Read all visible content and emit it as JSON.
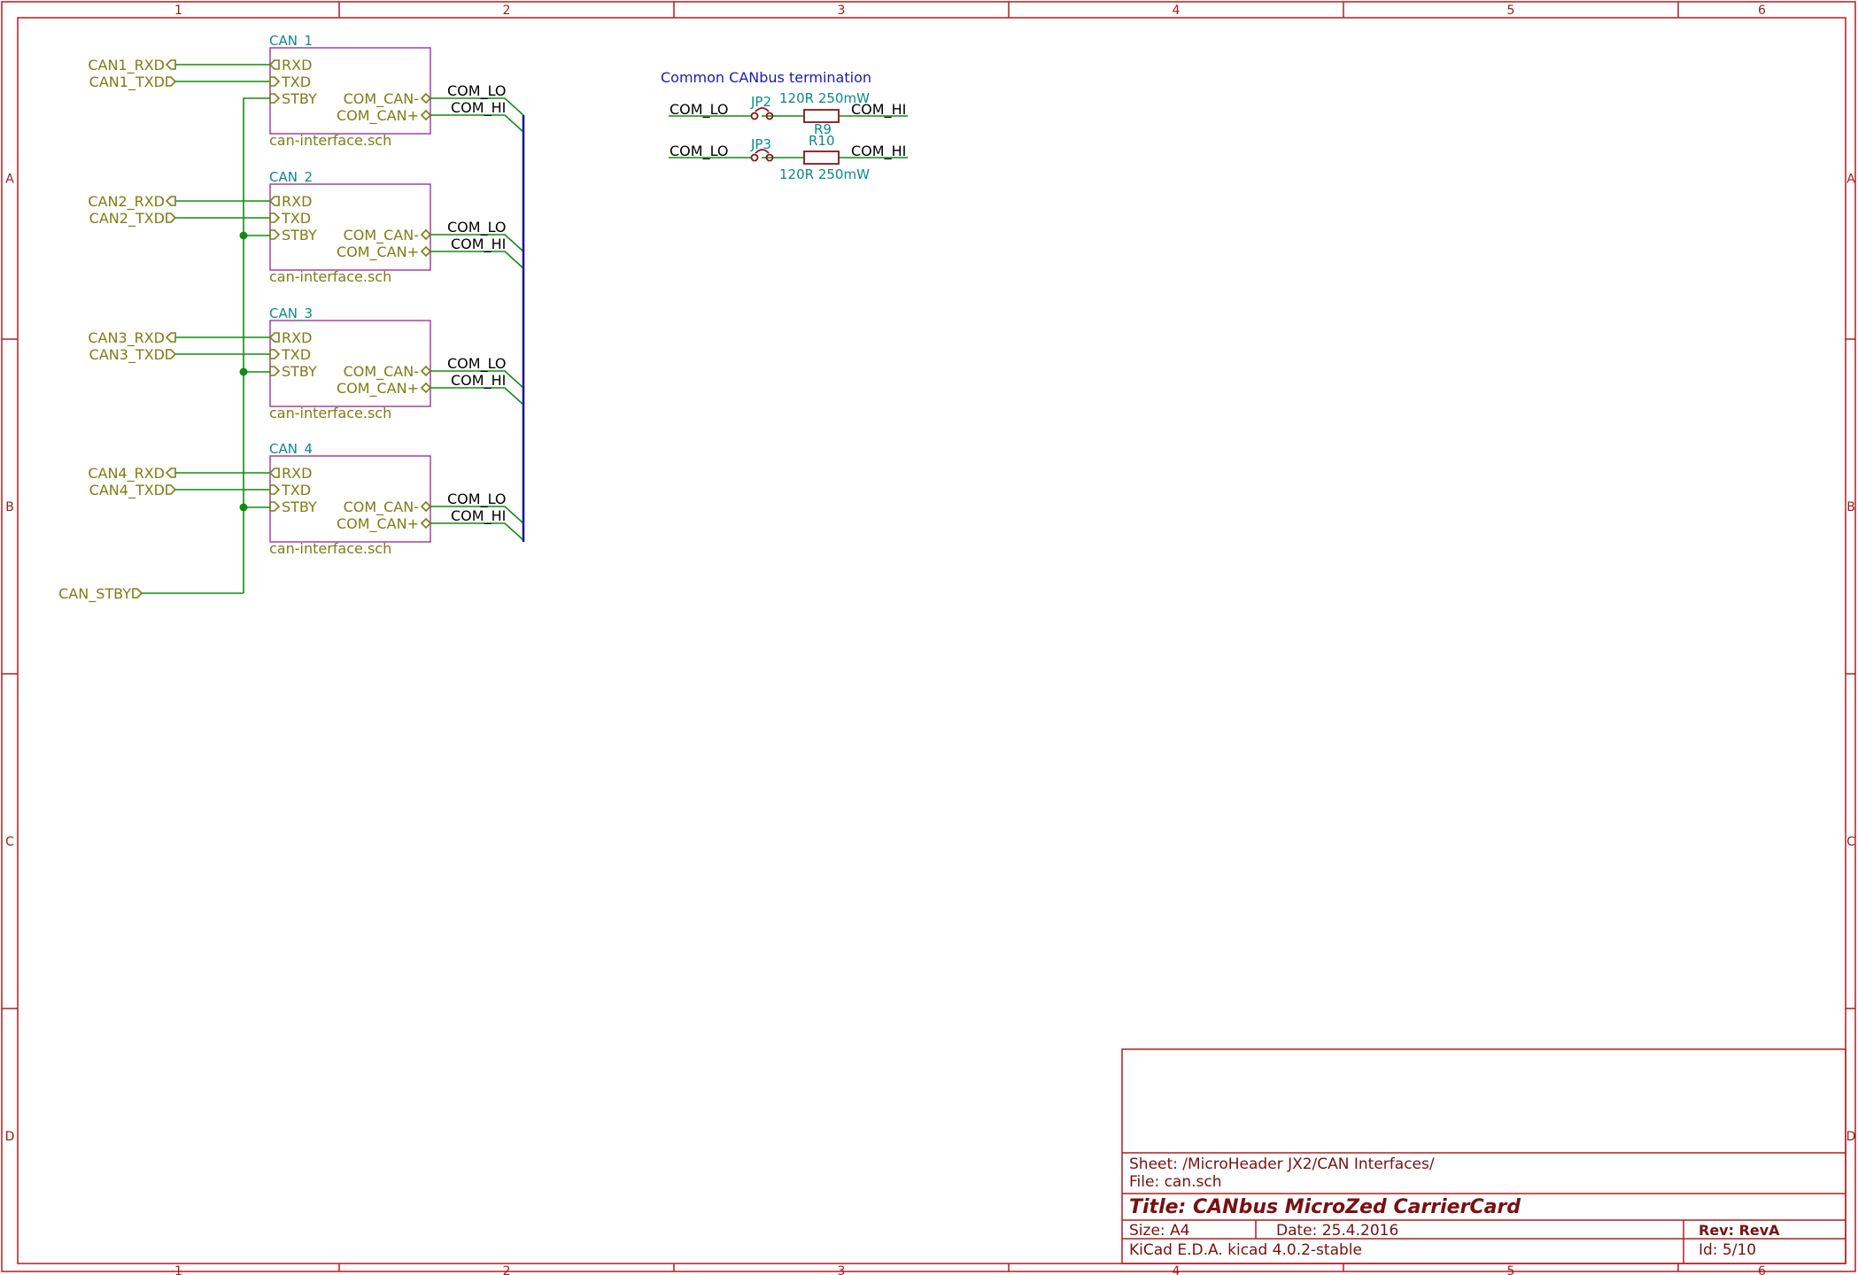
{
  "frame": {
    "columns": [
      "1",
      "2",
      "3",
      "4",
      "5",
      "6"
    ],
    "rows": [
      "A",
      "B",
      "C",
      "D"
    ]
  },
  "note": "Common CANbus termination",
  "global_labels": {
    "can1_rxd": "CAN1_RXD",
    "can1_txd": "CAN1_TXD",
    "can2_rxd": "CAN2_RXD",
    "can2_txd": "CAN2_TXD",
    "can3_rxd": "CAN3_RXD",
    "can3_txd": "CAN3_TXD",
    "can4_rxd": "CAN4_RXD",
    "can4_txd": "CAN4_TXD",
    "can_stby": "CAN_STBY"
  },
  "sheets": [
    {
      "name": "CAN_1",
      "file": "can-interface.sch"
    },
    {
      "name": "CAN_2",
      "file": "can-interface.sch"
    },
    {
      "name": "CAN_3",
      "file": "can-interface.sch"
    },
    {
      "name": "CAN_4",
      "file": "can-interface.sch"
    }
  ],
  "sheet_pins": {
    "rxd": "RXD",
    "txd": "TXD",
    "stby": "STBY",
    "com_can_minus": "COM_CAN-",
    "com_can_plus": "COM_CAN+"
  },
  "net_labels": {
    "com_lo": "COM_LO",
    "com_hi": "COM_HI"
  },
  "termination": {
    "row1": {
      "jumper": "JP2",
      "resistor": "R9",
      "value": "120R 250mW"
    },
    "row2": {
      "jumper": "JP3",
      "resistor": "R10",
      "value": "120R 250mW"
    }
  },
  "title_block": {
    "sheet": "Sheet: /MicroHeader JX2/CAN Interfaces/",
    "file": "File: can.sch",
    "title": "Title: CANbus MicroZed CarrierCard",
    "size": "Size: A4",
    "date": "Date: 25.4.2016",
    "rev": "Rev: RevA",
    "tool": "KiCad E.D.A.  kicad 4.0.2-stable",
    "id": "Id: 5/10"
  },
  "colors": {
    "frame": "#b01e1e",
    "wire": "#138a13",
    "bus": "#1a1a8c",
    "hier_sheet": "#a032a0",
    "label": "#7d7d14",
    "reference": "#0b8a8a",
    "note": "#1a1ab8"
  }
}
